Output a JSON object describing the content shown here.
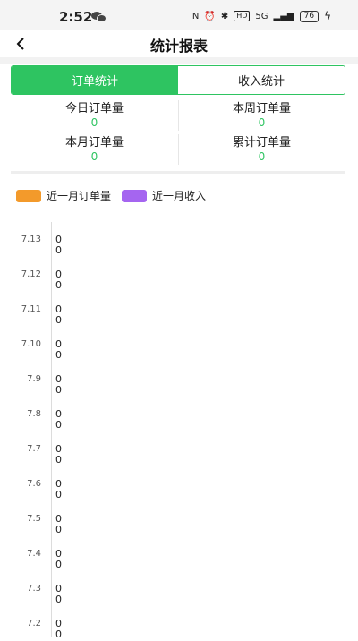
{
  "status": {
    "time": "2:52",
    "hd": "HD",
    "signal": "5G",
    "battery": "76"
  },
  "nav": {
    "title": "统计报表"
  },
  "tabs": [
    {
      "label": "订单统计",
      "active": true
    },
    {
      "label": "收入统计",
      "active": false
    }
  ],
  "stats": [
    {
      "label": "今日订单量",
      "value": "0"
    },
    {
      "label": "本周订单量",
      "value": "0"
    },
    {
      "label": "本月订单量",
      "value": "0"
    },
    {
      "label": "累计订单量",
      "value": "0"
    }
  ],
  "legend": [
    {
      "label": "近一月订单量",
      "color": "#f39a2b"
    },
    {
      "label": "近一月收入",
      "color": "#a565f0"
    }
  ],
  "chart_data": {
    "type": "bar",
    "categories": [
      "7.13",
      "7.12",
      "7.11",
      "7.10",
      "7.9",
      "7.8",
      "7.7",
      "7.6",
      "7.5",
      "7.4",
      "7.3",
      "7.2"
    ],
    "series": [
      {
        "name": "近一月订单量",
        "values": [
          0,
          0,
          0,
          0,
          0,
          0,
          0,
          0,
          0,
          0,
          0,
          0
        ]
      },
      {
        "name": "近一月收入",
        "values": [
          0,
          0,
          0,
          0,
          0,
          0,
          0,
          0,
          0,
          0,
          0,
          0
        ]
      }
    ]
  }
}
